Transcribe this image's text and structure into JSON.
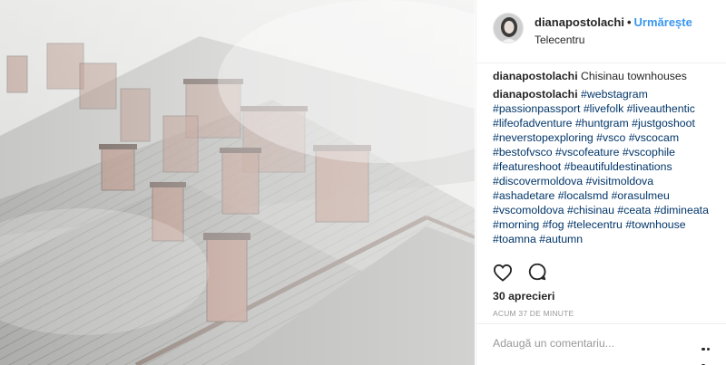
{
  "post": {
    "image_alt": "Chisinau townhouses rooftops with chimneys in fog",
    "author": {
      "username": "dianapostolachi",
      "follow_label": "Urmărește",
      "location": "Telecentru"
    },
    "caption": {
      "username": "dianapostolachi",
      "text": "Chisinau townhouses"
    },
    "hashtag_comment": {
      "username": "dianapostolachi",
      "tags": [
        "#webstagram",
        "#passionpassport",
        "#livefolk",
        "#liveauthentic",
        "#lifeofadventure",
        "#huntgram",
        "#justgoshoot",
        "#neverstopexploring",
        "#vsco",
        "#vscocam",
        "#bestofvsco",
        "#vscofeature",
        "#vscophile",
        "#featureshoot",
        "#beautifuldestinations",
        "#discovermoldova",
        "#visitmoldova",
        "#ashadetare",
        "#localsmd",
        "#orasulmeu",
        "#vscomoldova",
        "#chisinau",
        "#ceata",
        "#dimineata",
        "#morning",
        "#fog",
        "#telecentru",
        "#townhouse",
        "#toamna",
        "#autumn"
      ]
    },
    "likes_label": "30 aprecieri",
    "timestamp": "ACUM 37 DE MINUTE",
    "comment_placeholder": "Adaugă un comentariu...",
    "icons": {
      "like": "heart-icon",
      "comment": "comment-icon",
      "more": "more-options-icon"
    }
  }
}
